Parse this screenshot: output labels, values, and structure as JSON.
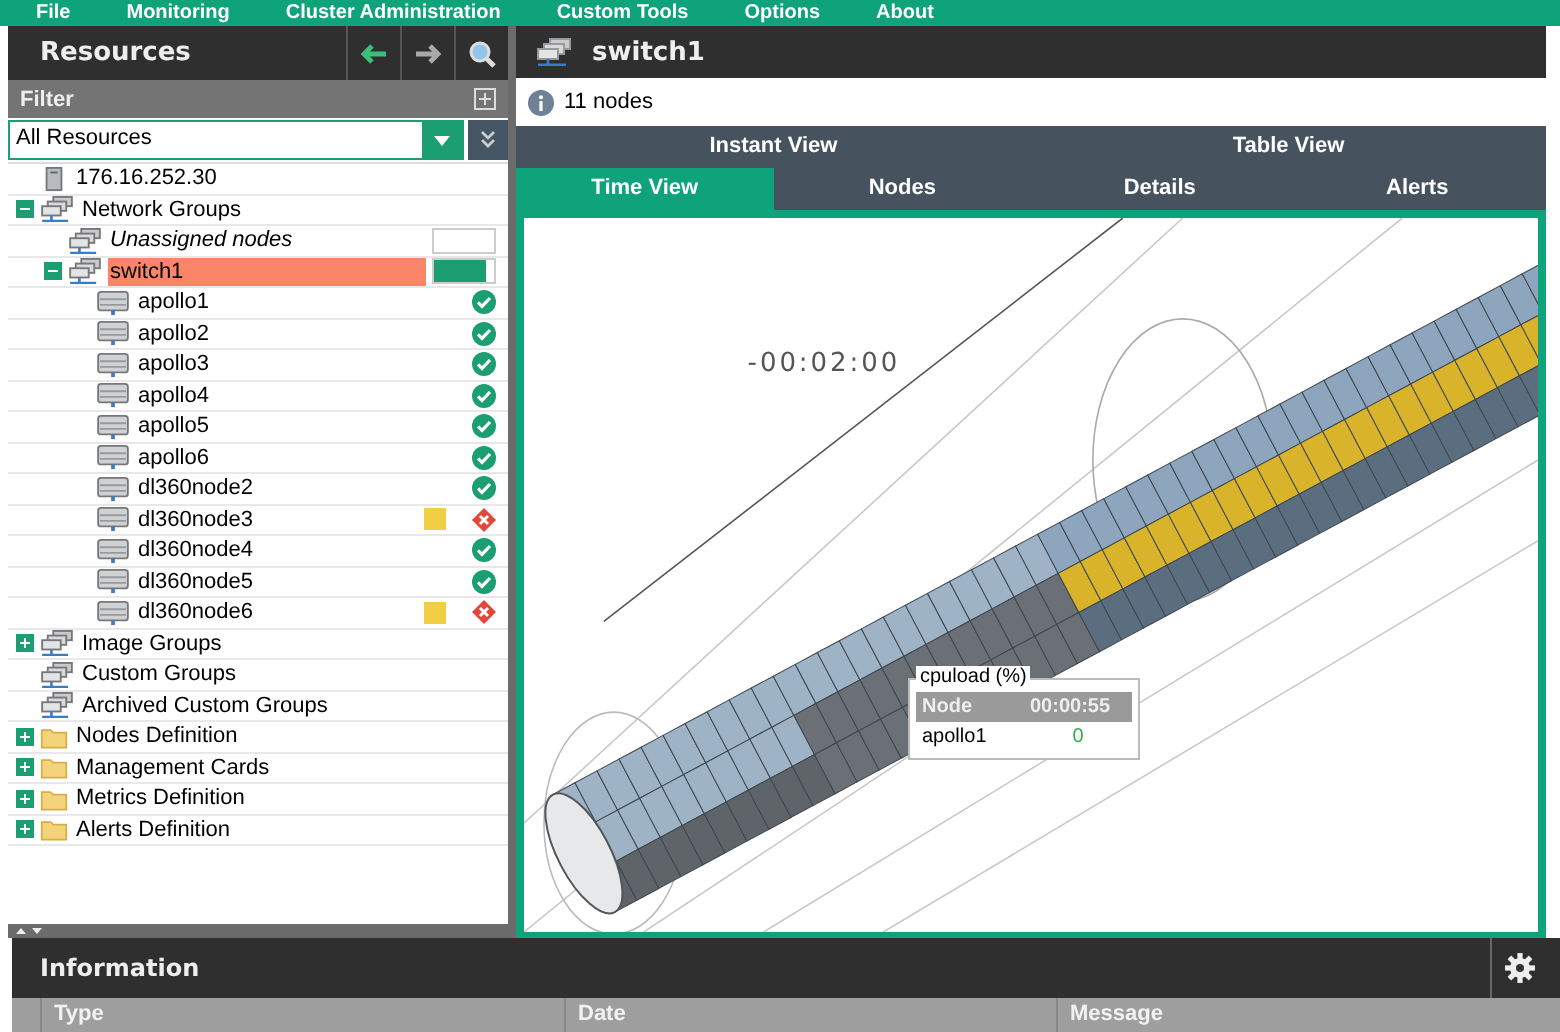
{
  "menu": [
    "File",
    "Monitoring",
    "Cluster Administration",
    "Custom Tools",
    "Options",
    "About"
  ],
  "left_panel": {
    "title": "Resources",
    "filter_label": "Filter",
    "dropdown_value": "All Resources"
  },
  "tree": [
    {
      "label": "176.16.252.30",
      "kind": "server",
      "selected": false
    },
    {
      "label": "Network Groups",
      "kind": "group",
      "expanded": true,
      "selected": false,
      "children": [
        {
          "label": "Unassigned nodes",
          "kind": "group",
          "italic": true,
          "selected": false,
          "bar": true
        },
        {
          "label": "switch1",
          "kind": "group",
          "expanded": true,
          "selected": true,
          "bar": true,
          "level": 0.88,
          "children": [
            {
              "label": "apollo1",
              "kind": "node",
              "selected": false,
              "critical": false,
              "warning": false
            },
            {
              "label": "apollo2",
              "kind": "node",
              "selected": false,
              "critical": false,
              "warning": false
            },
            {
              "label": "apollo3",
              "kind": "node",
              "selected": false,
              "critical": false,
              "warning": false
            },
            {
              "label": "apollo4",
              "kind": "node",
              "selected": false,
              "critical": false,
              "warning": false
            },
            {
              "label": "apollo5",
              "kind": "node",
              "selected": false,
              "critical": false,
              "warning": false
            },
            {
              "label": "apollo6",
              "kind": "node",
              "selected": false,
              "critical": false,
              "warning": false
            },
            {
              "label": "dl360node2",
              "kind": "node",
              "selected": false,
              "critical": false,
              "warning": false
            },
            {
              "label": "dl360node3",
              "kind": "node",
              "selected": false,
              "critical": true,
              "warning": true
            },
            {
              "label": "dl360node4",
              "kind": "node",
              "selected": false,
              "critical": false,
              "warning": false
            },
            {
              "label": "dl360node5",
              "kind": "node",
              "selected": false,
              "critical": false,
              "warning": false
            },
            {
              "label": "dl360node6",
              "kind": "node",
              "selected": false,
              "critical": true,
              "warning": true
            }
          ]
        }
      ]
    },
    {
      "label": "Image Groups",
      "kind": "group",
      "expanded": false,
      "selected": false
    },
    {
      "label": "Custom Groups",
      "kind": "group",
      "selected": false
    },
    {
      "label": "Archived Custom Groups",
      "kind": "group",
      "selected": false
    },
    {
      "label": "Nodes Definition",
      "kind": "folder",
      "expanded": false,
      "selected": false
    },
    {
      "label": "Management Cards",
      "kind": "folder",
      "expanded": false,
      "selected": false
    },
    {
      "label": "Metrics Definition",
      "kind": "folder",
      "expanded": false,
      "selected": false
    },
    {
      "label": "Alerts Definition",
      "kind": "folder",
      "expanded": false,
      "selected": false
    }
  ],
  "right_panel": {
    "title": "switch1",
    "info": "11 nodes",
    "view_groups": [
      "Instant View",
      "Table View"
    ],
    "tabs": [
      {
        "label": "Time View",
        "selected": true
      },
      {
        "label": "Nodes",
        "selected": false
      },
      {
        "label": "Details",
        "selected": false
      },
      {
        "label": "Alerts",
        "selected": false
      }
    ],
    "time_label": "-00:02:00",
    "tooltip": {
      "title": "cpuload (%)",
      "columns": [
        "Node",
        "00:00:55"
      ],
      "rows": [
        [
          "apollo1",
          "0"
        ]
      ]
    }
  },
  "information": {
    "title": "Information",
    "columns": [
      "Type",
      "Date",
      "Message"
    ]
  }
}
